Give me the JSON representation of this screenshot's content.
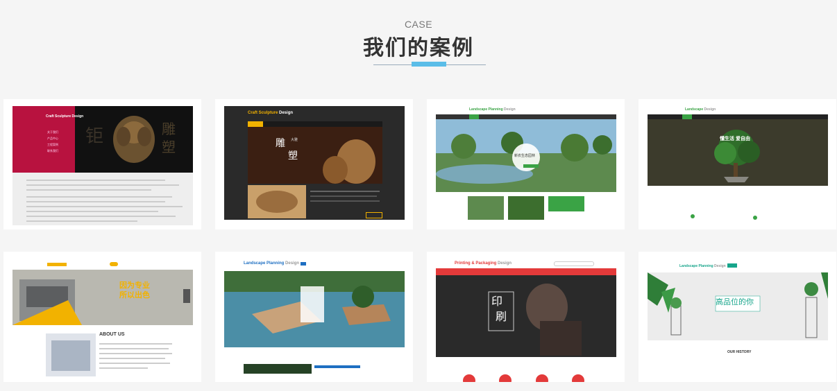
{
  "section": {
    "label": "CASE",
    "title": "我们的案例"
  },
  "cases": [
    {
      "brand": "Craft Sculpture Design",
      "hero_text": [
        "雕",
        "塑"
      ],
      "nav": [
        "关于我们",
        "产品中心",
        "工程案例",
        "联系我们"
      ]
    },
    {
      "brand_a": "Craft Sculpture",
      "brand_b": "Design",
      "hero_text": [
        "雕",
        "塑"
      ],
      "hero_small": "大雅"
    },
    {
      "brand_a": "Landscape Planning",
      "brand_b": "Design",
      "hero_text": "新农生态园林"
    },
    {
      "brand_a": "Landscape",
      "brand_b": "Design",
      "hero_text": "懂生活 爱自由"
    },
    {
      "hero_text": [
        "因为专业",
        "所以出色"
      ],
      "about_title": "ABOUT US"
    },
    {
      "brand_a": "Landscape Planning",
      "brand_b": "Design"
    },
    {
      "brand_a": "Printing & Packaging",
      "brand_b": "Design",
      "hero_text": [
        "印",
        "刷"
      ]
    },
    {
      "brand_a": "Landscape Planning",
      "brand_b": "Design",
      "hero_text": "高品位的你",
      "history": "OUR HISTORY"
    }
  ],
  "colors": {
    "accent": "#5bbde8",
    "title": "#333333",
    "crimson": "#b8123f",
    "gold": "#f2b200",
    "green": "#3aa345",
    "red": "#e33a3a",
    "blue": "#1e6fc2"
  }
}
